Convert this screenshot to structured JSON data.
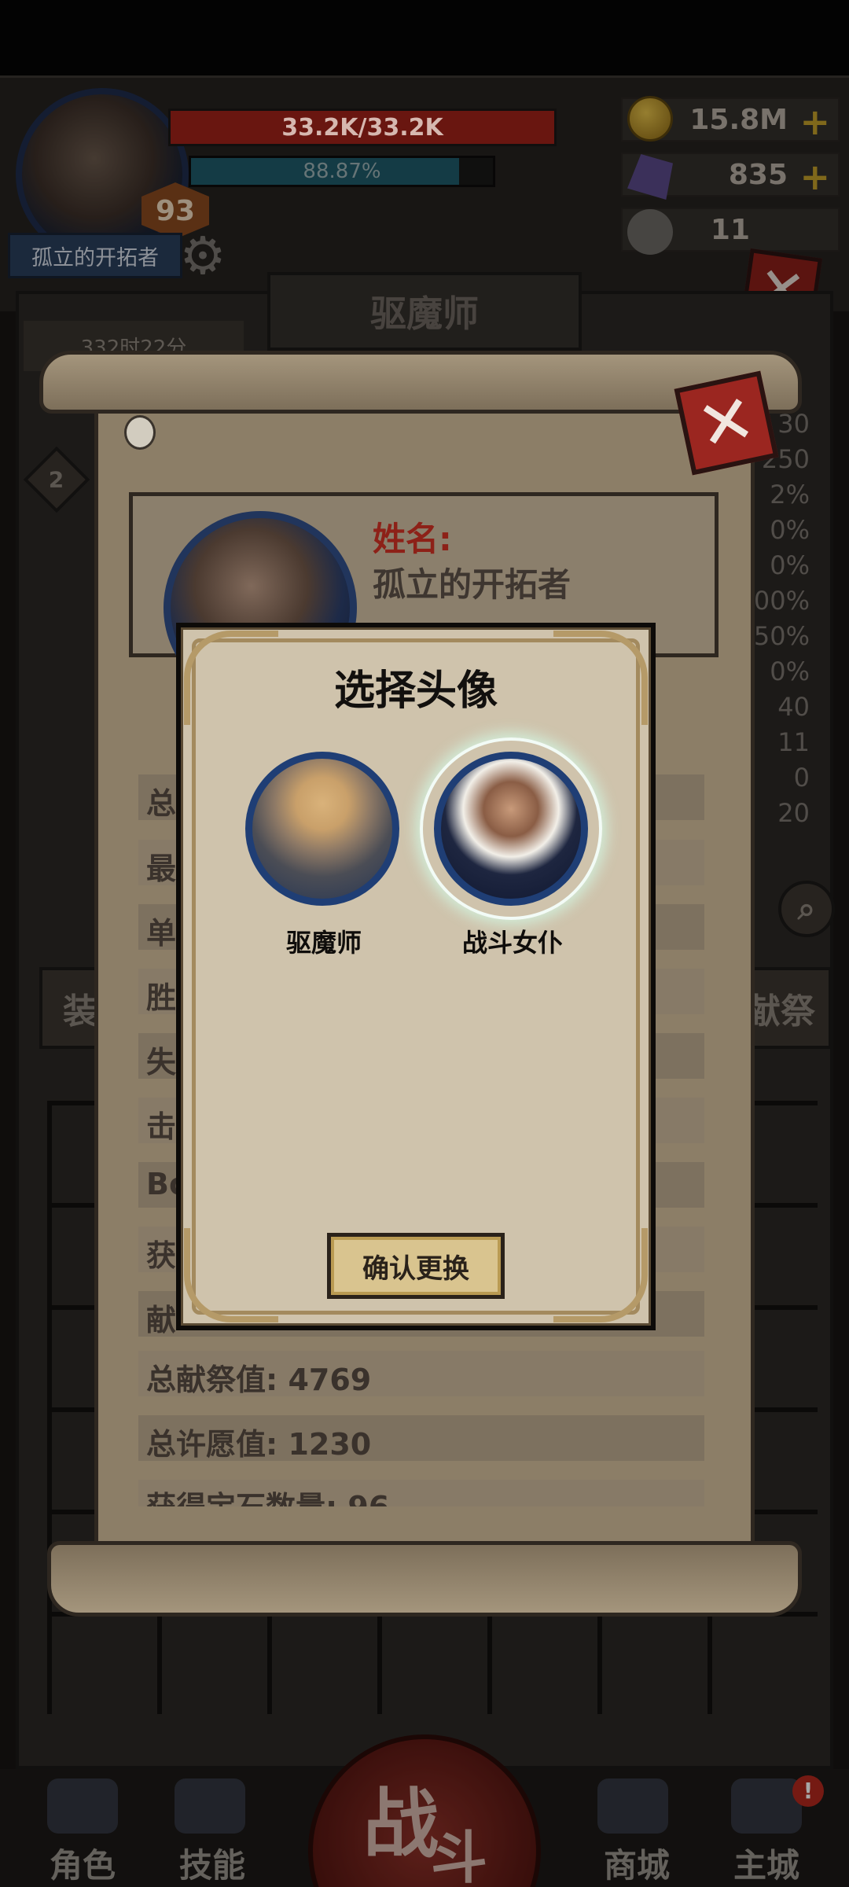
{
  "hud": {
    "hp_text": "33.2K/33.2K",
    "hp_fraction": 1.0,
    "xp_text": "88.87%",
    "xp_fraction": 0.8887,
    "level": "93",
    "player_name": "孤立的开拓者",
    "gold": "15.8M",
    "gems": "835",
    "tokens": "11",
    "plus": "+"
  },
  "background": {
    "title": "驱魔师",
    "timer": "332时22分",
    "side_values": [
      "30",
      "250",
      "2%",
      "0%",
      "0%",
      "00%",
      "50%",
      "0%",
      "40",
      "11",
      "0",
      "20"
    ],
    "side_left_button": "装",
    "side_right_button": "献祭",
    "close_symbol": "✕",
    "left_badge": "2"
  },
  "profile": {
    "name_label": "姓名:",
    "name_value": "孤立的开拓者",
    "stat_rows_hidden_prefixes": [
      "总",
      "最",
      "单",
      "胜",
      "失",
      "击",
      "Bo",
      "获",
      "献"
    ],
    "stat_rows": [
      {
        "label": "总献祭值:",
        "value": "4769"
      },
      {
        "label": "总许愿值:",
        "value": "1230"
      }
    ],
    "partial_row": "获得宝石数量: 96"
  },
  "modal": {
    "title": "选择头像",
    "choices": [
      {
        "label": "驱魔师",
        "selected": false
      },
      {
        "label": "战斗女仆",
        "selected": true
      }
    ],
    "confirm_label": "确认更换"
  },
  "bottom_nav": {
    "items": [
      "角色",
      "技能",
      "商城",
      "主城"
    ],
    "fight_top": "战",
    "fight_bottom": "斗",
    "notification": "!"
  },
  "colors": {
    "accent_red": "#9b2620",
    "portrait_ring_blue": "#1f3e75",
    "selected_glow": "#f2fbf6",
    "parchment": "#cfc3ac"
  }
}
